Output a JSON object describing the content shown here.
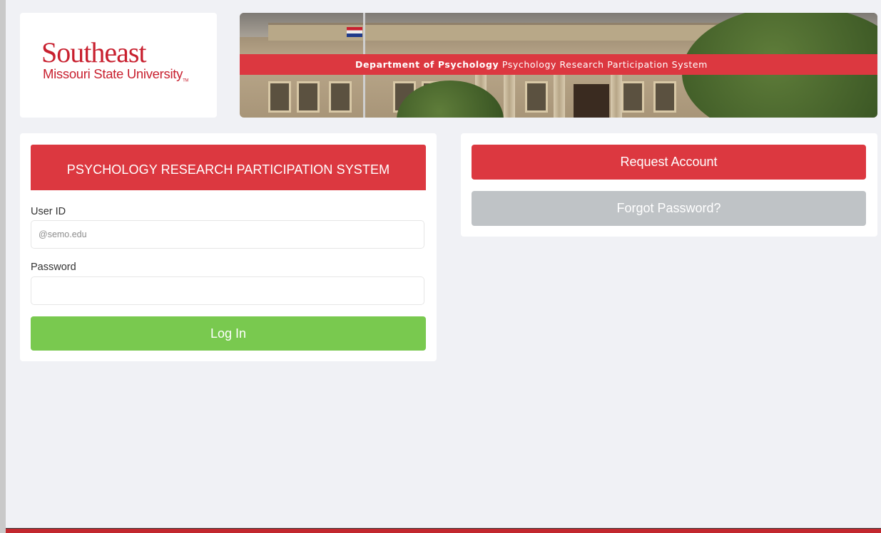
{
  "header": {
    "logo_main": "Southeast",
    "logo_sub": "Missouri State University",
    "logo_tm": "TM",
    "banner_dept": "Department of Psychology",
    "banner_system": "Psychology Research Participation System"
  },
  "login": {
    "title": "PSYCHOLOGY RESEARCH PARTICIPATION SYSTEM",
    "user_id_label": "User ID",
    "user_id_placeholder": "@semo.edu",
    "password_label": "Password",
    "login_button": "Log In"
  },
  "actions": {
    "request_account": "Request Account",
    "forgot_password": "Forgot Password?"
  },
  "colors": {
    "brand_red": "#dc3840",
    "login_green": "#79c94f",
    "muted_gray": "#bfc3c6",
    "background": "#f0f1f5"
  }
}
